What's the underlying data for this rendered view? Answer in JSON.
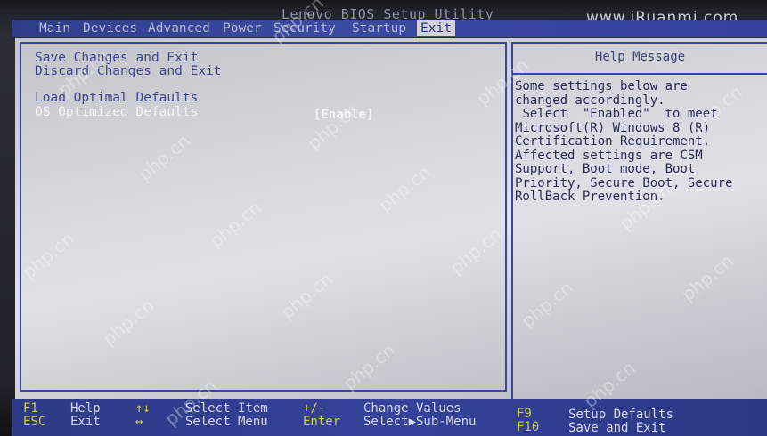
{
  "title": "Lenovo BIOS Setup Utility",
  "watermark_url": "www.iRuanmi.com",
  "menu_tabs": [
    "Main",
    "Devices",
    "Advanced",
    "Power",
    "Security",
    "Startup",
    "Exit"
  ],
  "active_tab": "Exit",
  "options": [
    {
      "label": "Save Changes and Exit",
      "value": ""
    },
    {
      "label": "Discard Changes and Exit",
      "value": ""
    },
    {
      "label": "Load Optimal Defaults",
      "value": ""
    },
    {
      "label": "OS Optimized Defaults",
      "value": "[Enable]"
    }
  ],
  "selected_option": "OS Optimized Defaults",
  "help": {
    "title": "Help Message",
    "text": "Some settings below are\nchanged accordingly.\n Select  \"Enabled\"  to meet\nMicrosoft(R) Windows 8 (R)\nCertification Requirement.\nAffected settings are CSM\nSupport, Boot mode, Boot\nPriority, Secure Boot, Secure\nRollBack Prevention."
  },
  "footer": {
    "f1_key": "F1",
    "f1_desc": "Help",
    "esc_key": "ESC",
    "esc_desc": "Exit",
    "updown_key": "↑↓",
    "updown_desc": "Select Item",
    "leftright_key": "↔",
    "leftright_desc": "Select Menu",
    "plusminus_key": "+/-",
    "plusminus_desc": "Change Values",
    "enter_key": "Enter",
    "enter_desc": "Select▶Sub-Menu",
    "f9_key": "F9",
    "f9_desc": "Setup Defaults",
    "f10_key": "F10",
    "f10_desc": "Save and Exit"
  },
  "watermarks": [
    "php.cn"
  ],
  "colors": {
    "menu_bar": "#34429a",
    "panel_bg": "#d7d8de",
    "border": "#3846a6",
    "key_yellow": "#c9d04e"
  }
}
